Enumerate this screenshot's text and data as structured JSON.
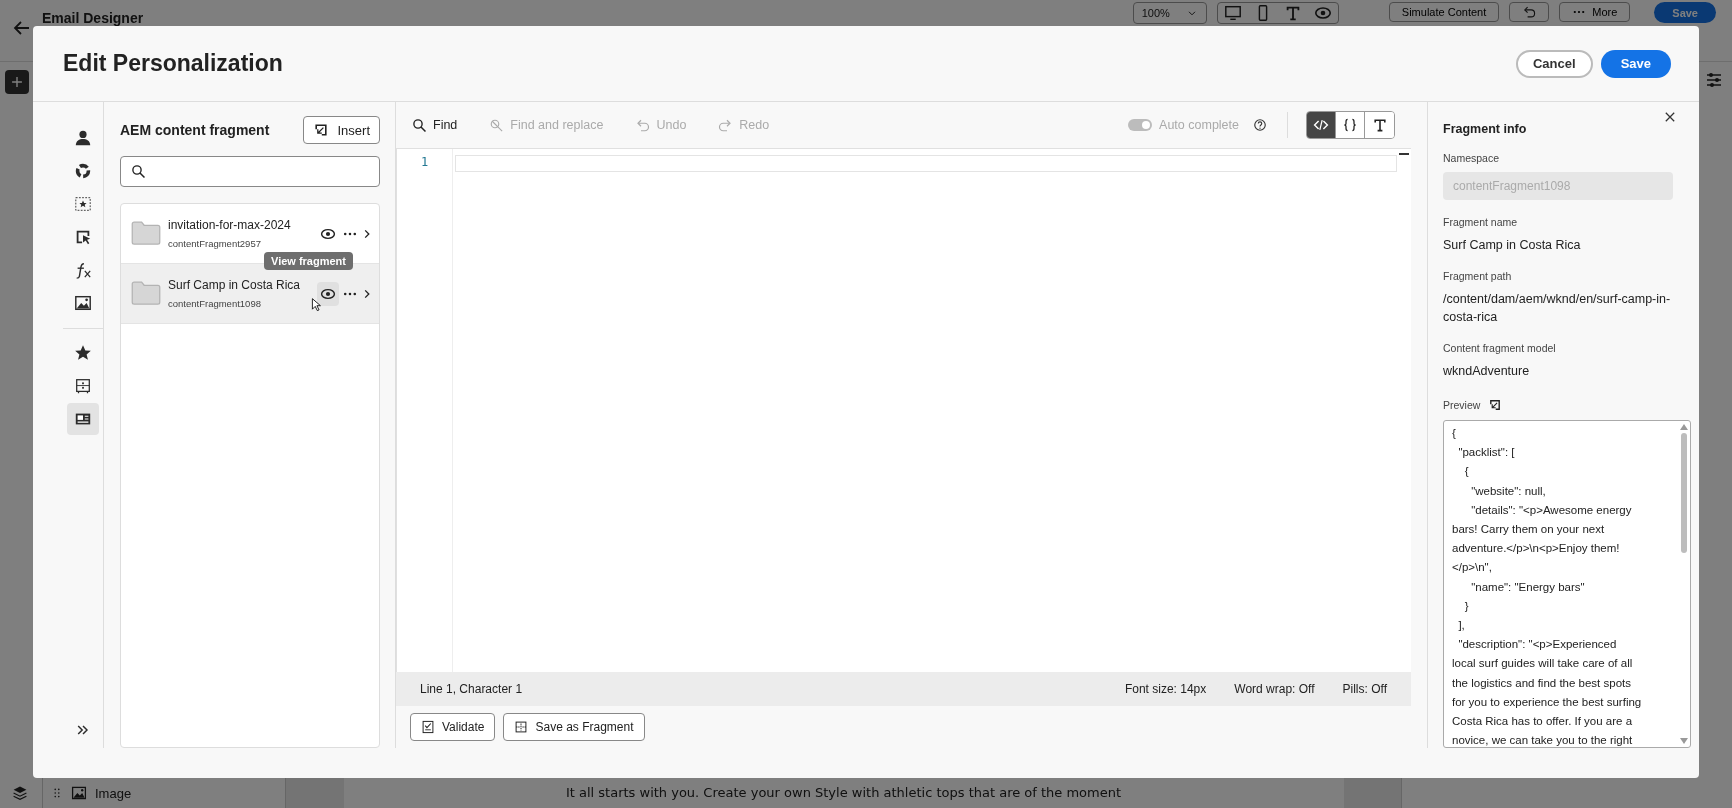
{
  "background": {
    "app_title": "Email Designer",
    "zoom": "100%",
    "simulate_button": "Simulate Content",
    "more_button": "More",
    "save_button": "Save",
    "layer_item": "Image",
    "body_text": "It all starts with you. Create your own Style with athletic tops that are of the moment"
  },
  "dialog": {
    "title": "Edit Personalization",
    "cancel_button": "Cancel",
    "save_button": "Save"
  },
  "rail": {
    "items": [
      {
        "kind": "profile",
        "selected": false
      },
      {
        "kind": "audience",
        "selected": false
      },
      {
        "kind": "offer",
        "selected": false
      },
      {
        "kind": "decision",
        "selected": false
      },
      {
        "kind": "function",
        "selected": false
      },
      {
        "kind": "asset",
        "selected": false
      },
      {
        "kind": "favorite",
        "selected": false
      },
      {
        "kind": "form",
        "selected": false
      },
      {
        "kind": "fragment",
        "selected": true
      }
    ]
  },
  "fragments": {
    "title": "AEM content fragment",
    "insert_button": "Insert",
    "items": [
      {
        "name": "invitation-for-max-2024",
        "id": "contentFragment2957",
        "selected": false
      },
      {
        "name": "Surf Camp in Costa Rica",
        "id": "contentFragment1098",
        "selected": true,
        "tooltip": "View fragment"
      }
    ]
  },
  "editor": {
    "toolbar": [
      {
        "kind": "find",
        "label": "Find",
        "disabled": false
      },
      {
        "kind": "replace",
        "label": "Find and replace",
        "disabled": true
      },
      {
        "kind": "undo",
        "label": "Undo",
        "disabled": true
      },
      {
        "kind": "redo",
        "label": "Redo",
        "disabled": true
      }
    ],
    "autocomplete": {
      "label": "Auto complete",
      "on": true,
      "disabled": true
    },
    "modes": [
      {
        "kind": "code",
        "selected": true
      },
      {
        "kind": "braces",
        "selected": false
      },
      {
        "kind": "text",
        "selected": false
      }
    ],
    "line_numbers": [
      "1"
    ],
    "status": {
      "position": "Line 1, Character 1",
      "font_size": "Font size: 14px",
      "word_wrap": "Word wrap: Off",
      "pills": "Pills: Off"
    },
    "footer": [
      {
        "kind": "validate",
        "label": "Validate"
      },
      {
        "kind": "fragment",
        "label": "Save as Fragment"
      }
    ]
  },
  "info": {
    "title": "Fragment info",
    "fields": [
      {
        "kind": "readonly",
        "label": "Namespace",
        "value": "contentFragment1098"
      },
      {
        "kind": "text",
        "label": "Fragment name",
        "value": "Surf Camp in Costa Rica"
      },
      {
        "kind": "text",
        "label": "Fragment path",
        "value": "/content/dam/aem/wknd/en/surf-camp-in-costa-rica"
      },
      {
        "kind": "text",
        "label": "Content fragment model",
        "value": "wkndAdventure"
      }
    ],
    "preview": {
      "label": "Preview",
      "text": "{\n  \"packlist\": [\n    {\n      \"website\": null,\n      \"details\": \"<p>Awesome energy\nbars! Carry them on your next\nadventure.</p>\\n<p>Enjoy them!\n</p>\\n\",\n      \"name\": \"Energy bars\"\n    }\n  ],\n  \"description\": \"<p>Experienced\nlocal surf guides will take care of all\nthe logistics and find the best spots\nfor you to experience the best surfing\nCosta Rica has to offer. If you are a\nnovice, we can take you to the right"
    }
  }
}
